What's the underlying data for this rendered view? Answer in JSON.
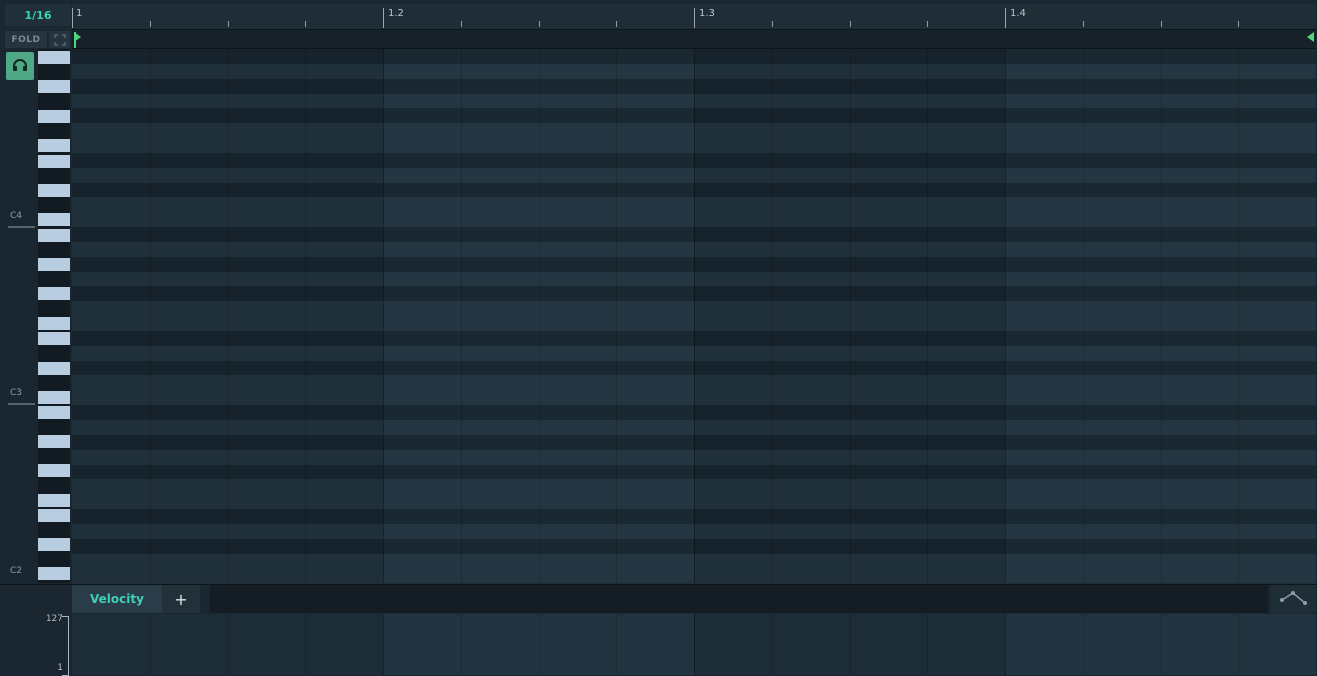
{
  "header": {
    "grid_value": "1/16",
    "bar_labels": [
      "1",
      "1.2",
      "1.3",
      "1.4"
    ]
  },
  "fold": {
    "label": "FOLD"
  },
  "keyboard": {
    "octave_labels": [
      "C4",
      "C3",
      "C2"
    ]
  },
  "icons": {
    "headphones": "headphones-icon",
    "expand": "expand-icon",
    "curve": "curve-tool-icon"
  },
  "velocity_lane": {
    "tabs": [
      "Velocity"
    ],
    "add_label": "+",
    "max_value": "127",
    "min_value": "1"
  },
  "colors": {
    "accent": "#3ed0b6",
    "loop_marker": "#53d37c",
    "listen_button": "#4fa886"
  }
}
